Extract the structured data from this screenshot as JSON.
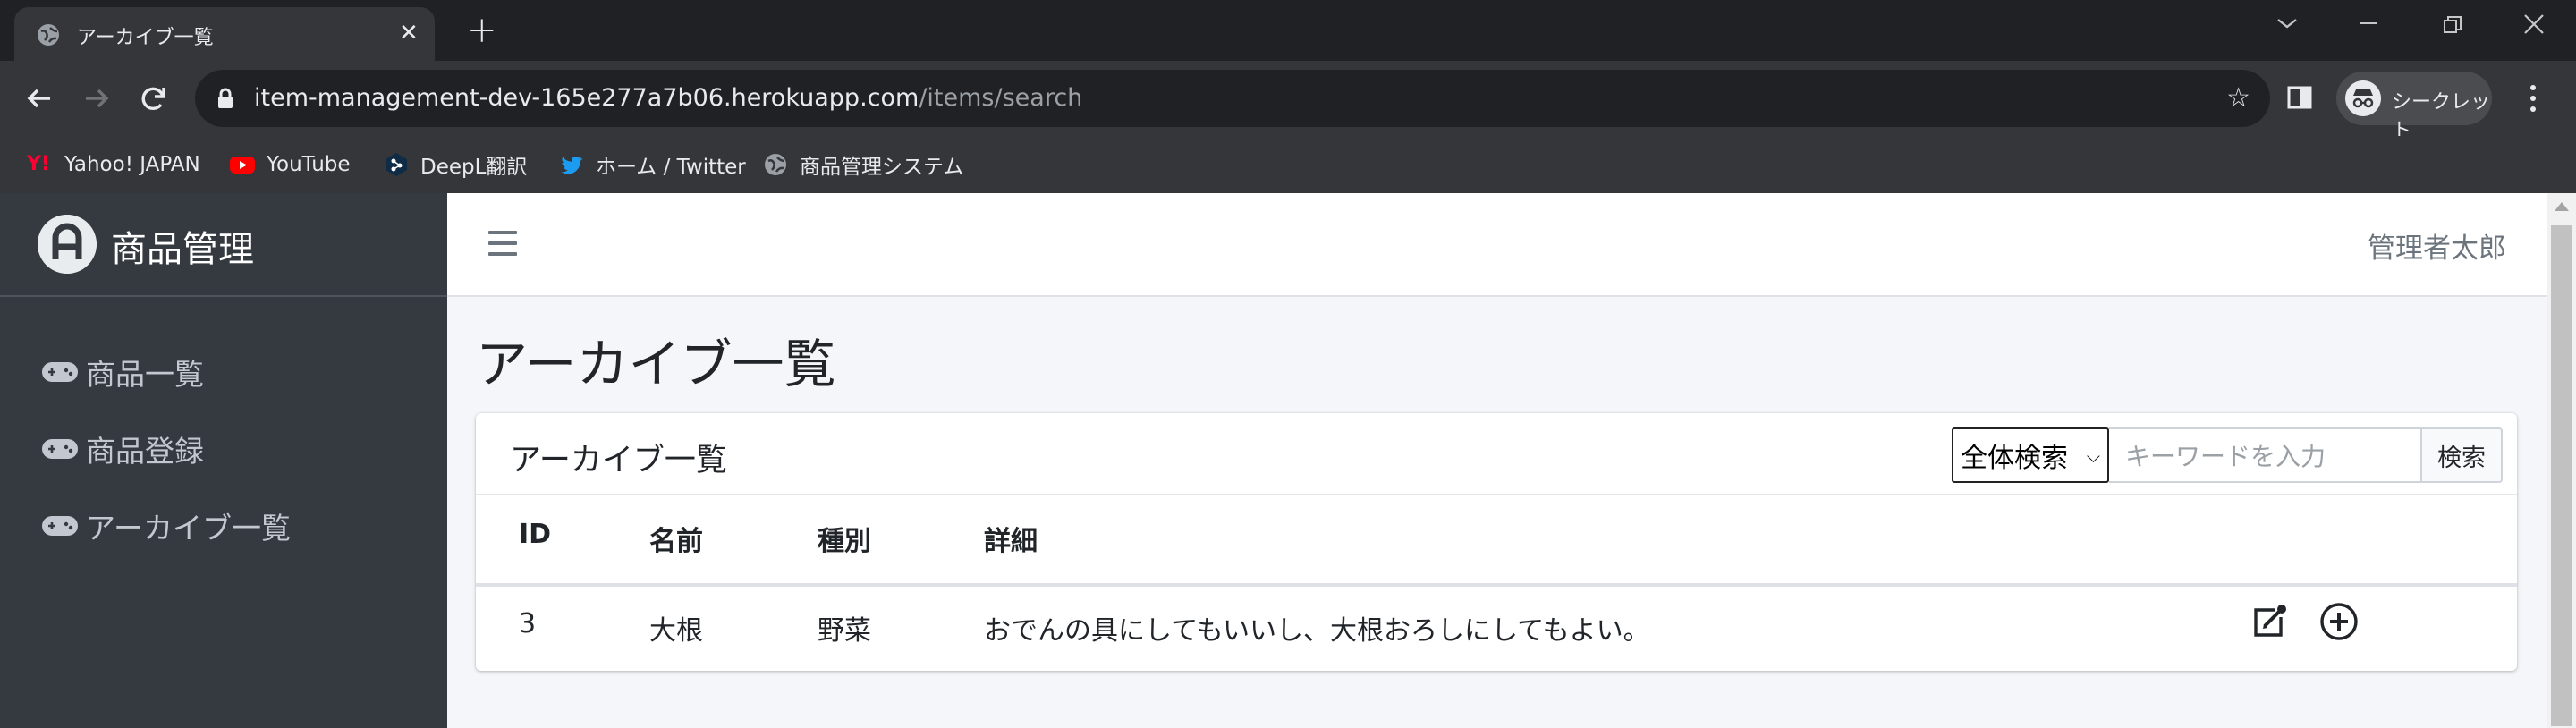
{
  "browser": {
    "tab_title": "アーカイブ一覧",
    "url_host": "item-management-dev-165e277a7b06.herokuapp.com",
    "url_path": "/items/search",
    "incognito_label": "シークレット",
    "bookmarks": [
      {
        "label": "Yahoo! JAPAN",
        "icon": "yahoo-icon"
      },
      {
        "label": "YouTube",
        "icon": "youtube-icon"
      },
      {
        "label": "DeepL翻訳",
        "icon": "deepl-icon"
      },
      {
        "label": "ホーム / Twitter",
        "icon": "twitter-icon"
      },
      {
        "label": "商品管理システム",
        "icon": "globe-icon"
      }
    ]
  },
  "sidebar": {
    "brand": "商品管理",
    "items": [
      {
        "label": "商品一覧",
        "icon": "gamepad-icon"
      },
      {
        "label": "商品登録",
        "icon": "gamepad-icon"
      },
      {
        "label": "アーカイブ一覧",
        "icon": "gamepad-icon"
      }
    ]
  },
  "header": {
    "user_name": "管理者太郎"
  },
  "main": {
    "page_title": "アーカイブ一覧",
    "card_title": "アーカイブ一覧",
    "search": {
      "select_value": "全体検索",
      "placeholder": "キーワードを入力",
      "button_label": "検索"
    },
    "table": {
      "columns": [
        "ID",
        "名前",
        "種別",
        "詳細"
      ],
      "rows": [
        {
          "id": "3",
          "name": "大根",
          "type": "野菜",
          "detail": "おでんの具にしてもいいし、大根おろしにしてもよい。",
          "actions": [
            "edit-icon",
            "plus-circle-icon"
          ]
        }
      ]
    }
  },
  "colors": {
    "sidebar_bg": "#343a40",
    "content_bg": "#f4f6f9",
    "chrome_bg": "#202124",
    "chrome_toolbar": "#35363a"
  }
}
